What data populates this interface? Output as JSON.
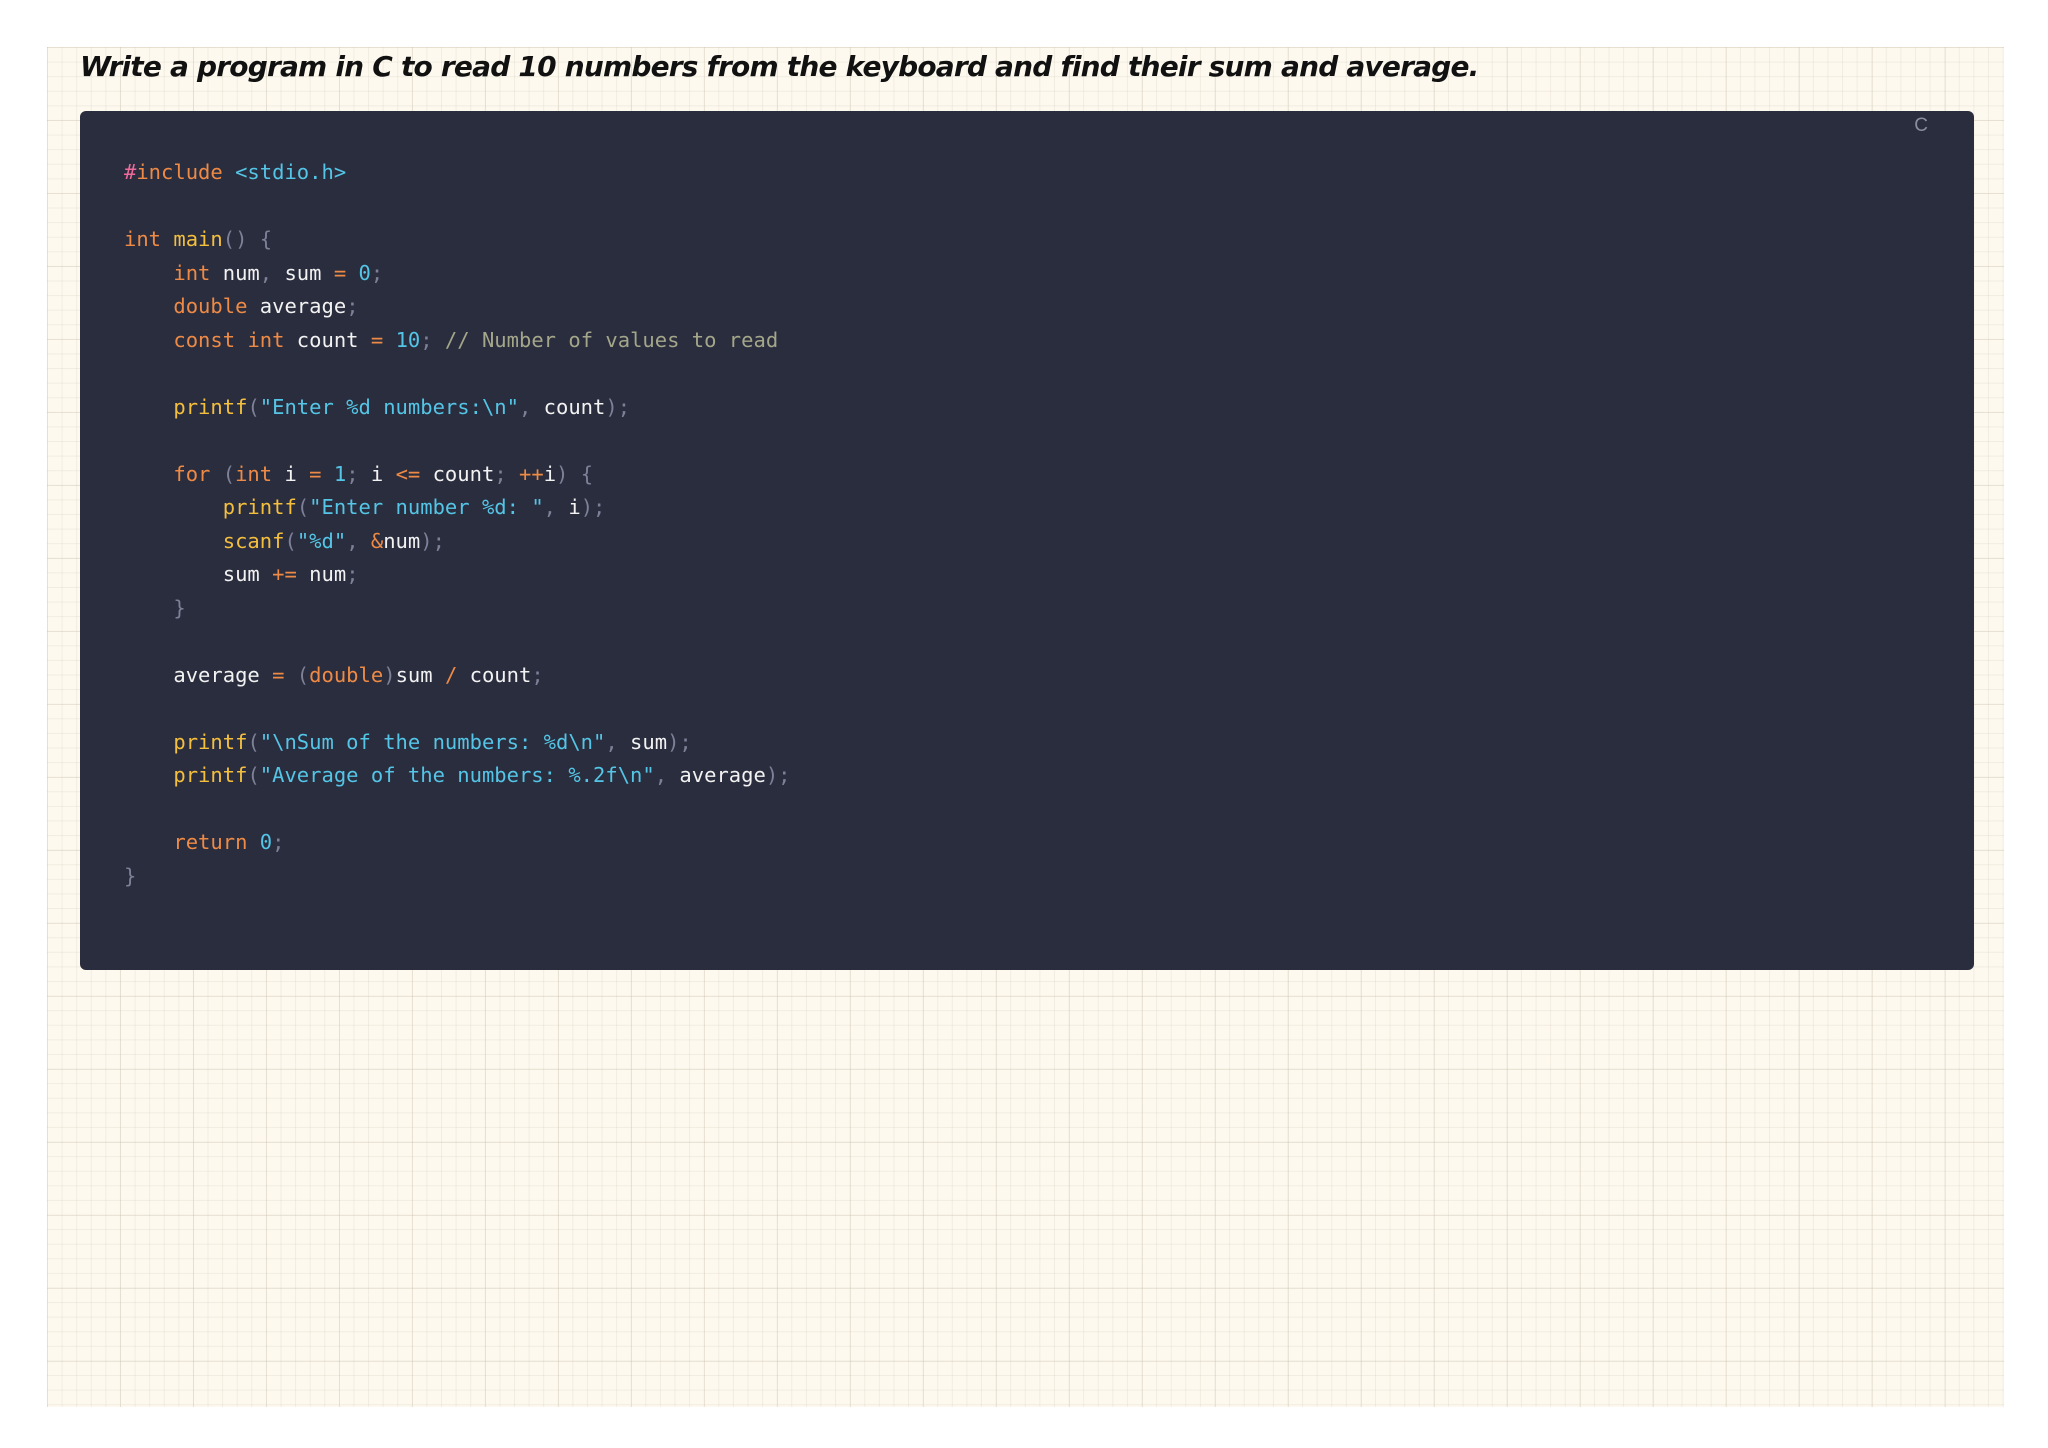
{
  "title": "Write a program in C to read 10 numbers from the keyboard and find their sum and average.",
  "code_block": {
    "language": "C",
    "lines": [
      [
        {
          "t": "#",
          "c": "pre"
        },
        {
          "t": "include",
          "c": "kw"
        },
        {
          "t": " ",
          "c": "id"
        },
        {
          "t": "<stdio.h>",
          "c": "inc"
        }
      ],
      [],
      [
        {
          "t": "int",
          "c": "kw"
        },
        {
          "t": " ",
          "c": "id"
        },
        {
          "t": "main",
          "c": "fn"
        },
        {
          "t": "() {",
          "c": "punc"
        }
      ],
      [
        {
          "t": "    ",
          "c": "id"
        },
        {
          "t": "int",
          "c": "kw"
        },
        {
          "t": " num",
          "c": "id"
        },
        {
          "t": ",",
          "c": "punc"
        },
        {
          "t": " sum ",
          "c": "id"
        },
        {
          "t": "=",
          "c": "op"
        },
        {
          "t": " ",
          "c": "id"
        },
        {
          "t": "0",
          "c": "num"
        },
        {
          "t": ";",
          "c": "punc"
        }
      ],
      [
        {
          "t": "    ",
          "c": "id"
        },
        {
          "t": "double",
          "c": "kw"
        },
        {
          "t": " average",
          "c": "id"
        },
        {
          "t": ";",
          "c": "punc"
        }
      ],
      [
        {
          "t": "    ",
          "c": "id"
        },
        {
          "t": "const",
          "c": "kw"
        },
        {
          "t": " ",
          "c": "id"
        },
        {
          "t": "int",
          "c": "kw"
        },
        {
          "t": " count ",
          "c": "id"
        },
        {
          "t": "=",
          "c": "op"
        },
        {
          "t": " ",
          "c": "id"
        },
        {
          "t": "10",
          "c": "num"
        },
        {
          "t": ";",
          "c": "punc"
        },
        {
          "t": " // Number of values to read",
          "c": "com"
        }
      ],
      [],
      [
        {
          "t": "    ",
          "c": "id"
        },
        {
          "t": "printf",
          "c": "fn"
        },
        {
          "t": "(",
          "c": "punc"
        },
        {
          "t": "\"Enter %d numbers:\\n\"",
          "c": "str"
        },
        {
          "t": ",",
          "c": "punc"
        },
        {
          "t": " count",
          "c": "id"
        },
        {
          "t": ");",
          "c": "punc"
        }
      ],
      [],
      [
        {
          "t": "    ",
          "c": "id"
        },
        {
          "t": "for",
          "c": "kw"
        },
        {
          "t": " (",
          "c": "punc"
        },
        {
          "t": "int",
          "c": "kw"
        },
        {
          "t": " i ",
          "c": "id"
        },
        {
          "t": "=",
          "c": "op"
        },
        {
          "t": " ",
          "c": "id"
        },
        {
          "t": "1",
          "c": "num"
        },
        {
          "t": ";",
          "c": "punc"
        },
        {
          "t": " i ",
          "c": "id"
        },
        {
          "t": "<=",
          "c": "op"
        },
        {
          "t": " count",
          "c": "id"
        },
        {
          "t": ";",
          "c": "punc"
        },
        {
          "t": " ",
          "c": "id"
        },
        {
          "t": "++",
          "c": "op"
        },
        {
          "t": "i",
          "c": "id"
        },
        {
          "t": ") {",
          "c": "punc"
        }
      ],
      [
        {
          "t": "        ",
          "c": "id"
        },
        {
          "t": "printf",
          "c": "fn"
        },
        {
          "t": "(",
          "c": "punc"
        },
        {
          "t": "\"Enter number %d: \"",
          "c": "str"
        },
        {
          "t": ",",
          "c": "punc"
        },
        {
          "t": " i",
          "c": "id"
        },
        {
          "t": ");",
          "c": "punc"
        }
      ],
      [
        {
          "t": "        ",
          "c": "id"
        },
        {
          "t": "scanf",
          "c": "fn"
        },
        {
          "t": "(",
          "c": "punc"
        },
        {
          "t": "\"%d\"",
          "c": "str"
        },
        {
          "t": ",",
          "c": "punc"
        },
        {
          "t": " ",
          "c": "id"
        },
        {
          "t": "&",
          "c": "op"
        },
        {
          "t": "num",
          "c": "id"
        },
        {
          "t": ");",
          "c": "punc"
        }
      ],
      [
        {
          "t": "        ",
          "c": "id"
        },
        {
          "t": "sum ",
          "c": "id"
        },
        {
          "t": "+=",
          "c": "op"
        },
        {
          "t": " num",
          "c": "id"
        },
        {
          "t": ";",
          "c": "punc"
        }
      ],
      [
        {
          "t": "    ",
          "c": "id"
        },
        {
          "t": "}",
          "c": "punc"
        }
      ],
      [],
      [
        {
          "t": "    ",
          "c": "id"
        },
        {
          "t": "average ",
          "c": "id"
        },
        {
          "t": "=",
          "c": "op"
        },
        {
          "t": " (",
          "c": "punc"
        },
        {
          "t": "double",
          "c": "kw"
        },
        {
          "t": ")",
          "c": "punc"
        },
        {
          "t": "sum ",
          "c": "id"
        },
        {
          "t": "/",
          "c": "op"
        },
        {
          "t": " count",
          "c": "id"
        },
        {
          "t": ";",
          "c": "punc"
        }
      ],
      [],
      [
        {
          "t": "    ",
          "c": "id"
        },
        {
          "t": "printf",
          "c": "fn"
        },
        {
          "t": "(",
          "c": "punc"
        },
        {
          "t": "\"\\nSum of the numbers: %d\\n\"",
          "c": "str"
        },
        {
          "t": ",",
          "c": "punc"
        },
        {
          "t": " sum",
          "c": "id"
        },
        {
          "t": ");",
          "c": "punc"
        }
      ],
      [
        {
          "t": "    ",
          "c": "id"
        },
        {
          "t": "printf",
          "c": "fn"
        },
        {
          "t": "(",
          "c": "punc"
        },
        {
          "t": "\"Average of the numbers: %.2f\\n\"",
          "c": "str"
        },
        {
          "t": ",",
          "c": "punc"
        },
        {
          "t": " average",
          "c": "id"
        },
        {
          "t": ");",
          "c": "punc"
        }
      ],
      [],
      [
        {
          "t": "    ",
          "c": "id"
        },
        {
          "t": "return",
          "c": "kw"
        },
        {
          "t": " ",
          "c": "id"
        },
        {
          "t": "0",
          "c": "num"
        },
        {
          "t": ";",
          "c": "punc"
        }
      ],
      [
        {
          "t": "}",
          "c": "punc"
        }
      ]
    ]
  },
  "colors": {
    "code_background": "#2a2d3e",
    "keyword": "#ee8a45",
    "function": "#f4bf3d",
    "string": "#54c5e6",
    "comment": "#a4a68a",
    "paper": "#fdf9ef"
  }
}
